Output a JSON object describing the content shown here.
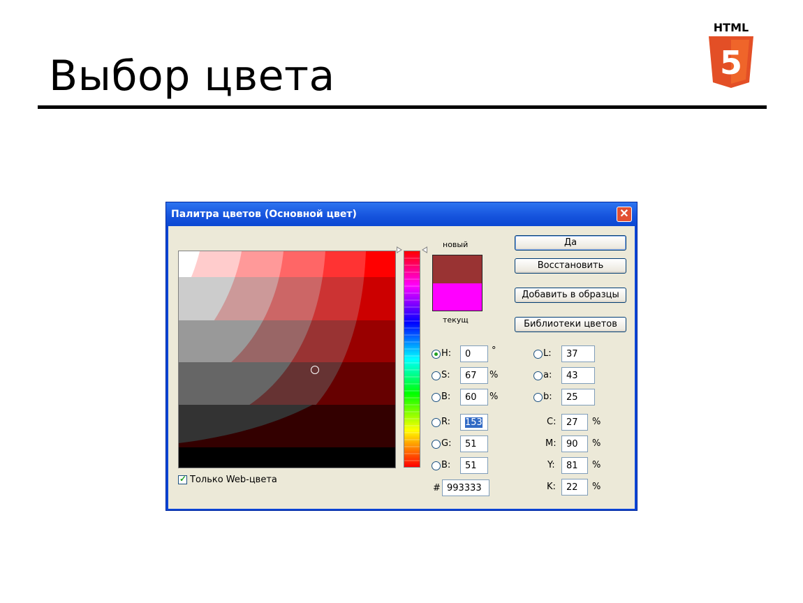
{
  "slide": {
    "title": "Выбор цвета",
    "logo_text": "HTML",
    "logo_number": "5"
  },
  "dialog": {
    "title": "Палитра цветов (Основной цвет)",
    "close_glyph": "✕",
    "new_label": "новый",
    "current_label": "текущ",
    "new_color": "#993333",
    "current_color": "#ff00ff",
    "buttons": {
      "ok": "Да",
      "reset": "Восстановить",
      "add_swatches": "Добавить в образцы",
      "libraries": "Библиотеки цветов"
    },
    "hsb": {
      "h_label": "H:",
      "h": "0",
      "h_unit": "°",
      "s_label": "S:",
      "s": "67",
      "s_unit": "%",
      "b_label": "B:",
      "b": "60",
      "b_unit": "%"
    },
    "lab": {
      "l_label": "L:",
      "l": "37",
      "a_label": "a:",
      "a": "43",
      "b_label": "b:",
      "b": "25"
    },
    "rgb": {
      "r_label": "R:",
      "r": "153",
      "g_label": "G:",
      "g": "51",
      "b_label": "B:",
      "b": "51"
    },
    "cmyk": {
      "c_label": "C:",
      "c": "27",
      "m_label": "M:",
      "m": "90",
      "y_label": "Y:",
      "y": "81",
      "k_label": "K:",
      "k": "22",
      "unit": "%"
    },
    "hex_label": "#",
    "hex": "993333",
    "web_only_label": "Только Web-цвета",
    "web_only_checked": true,
    "selected_mode": "H"
  }
}
